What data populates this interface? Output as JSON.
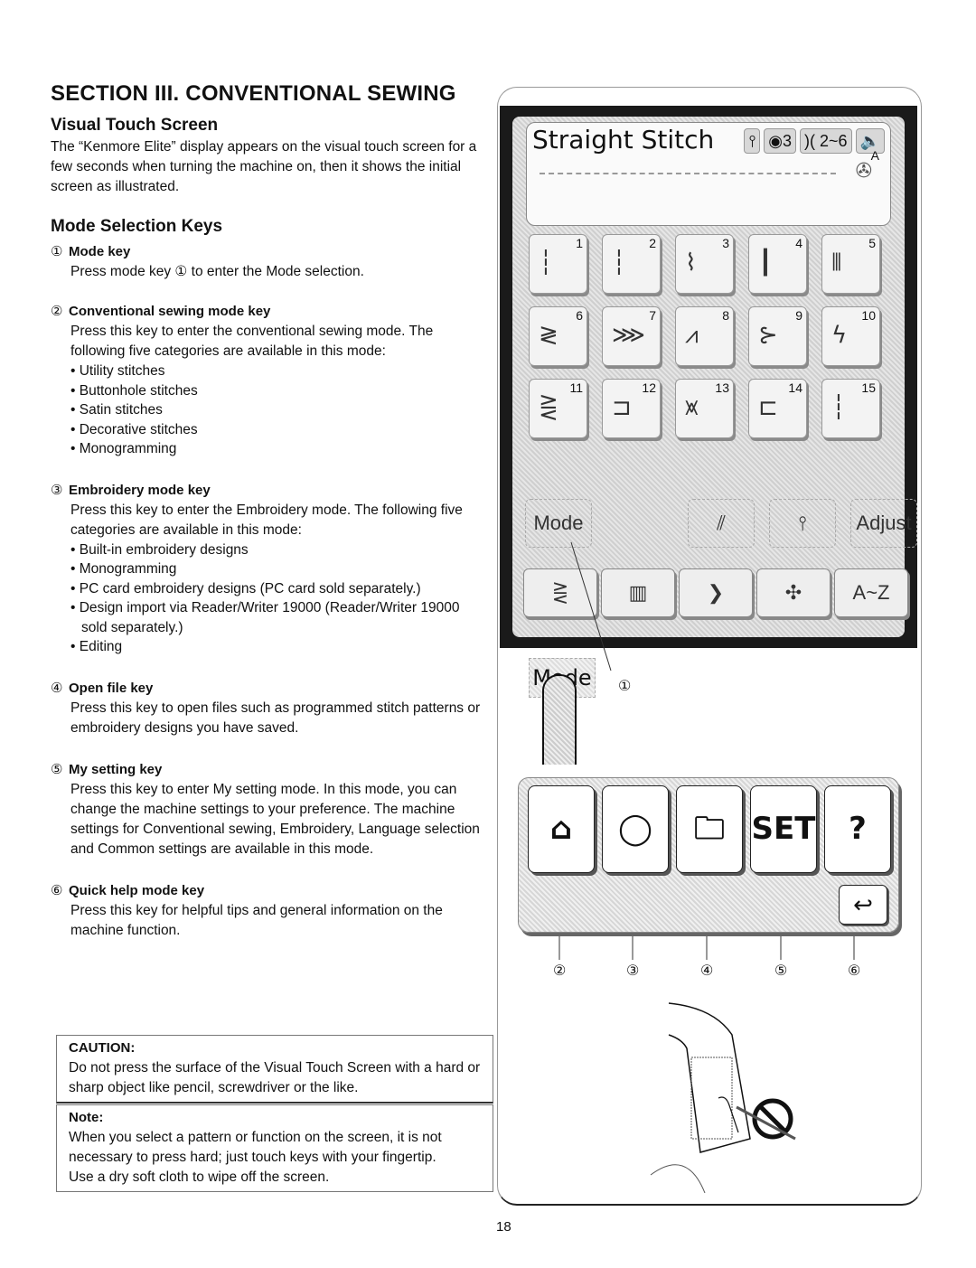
{
  "section_title": "SECTION III. CONVENTIONAL SEWING",
  "visual_touch": {
    "heading": "Visual Touch Screen",
    "body": "The “Kenmore Elite” display appears on the visual touch screen for a few seconds when turning the machine on, then it shows the initial screen as illustrated."
  },
  "mode_selection": {
    "heading": "Mode Selection Keys",
    "items": [
      {
        "num": "①",
        "title": "Mode key",
        "body": "Press mode key ① to enter the Mode selection.",
        "bullets": [],
        "extra": ""
      },
      {
        "num": "②",
        "title": "Conventional sewing mode key",
        "body": "Press this key to enter the conventional sewing mode. The following five categories are available in this mode:",
        "bullets": [
          "Utility stitches",
          "Buttonhole stitches",
          "Satin stitches",
          "Decorative stitches",
          "Monogramming"
        ]
      },
      {
        "num": "③",
        "title": "Embroidery mode key",
        "body": "Press this key to enter the Embroidery mode. The following five categories are available in this mode:",
        "bullets": [
          "Built-in embroidery designs",
          "Monogramming",
          "PC card embroidery designs (PC card sold separately.)",
          "Design import via Reader/Writer 19000 (Reader/Writer 19000 sold separately.)",
          "Editing"
        ]
      },
      {
        "num": "④",
        "title": "Open file key",
        "body": "Press this key to open files such as programmed stitch patterns or embroidery designs you have saved.",
        "bullets": []
      },
      {
        "num": "⑤",
        "title": "My setting key",
        "body": "Press this key to enter My setting mode. In this mode, you can change the machine settings to your preference. The machine settings for Conventional sewing, Embroidery, Language selection and Common settings are available in this mode.",
        "bullets": []
      },
      {
        "num": "⑥",
        "title": "Quick help mode key",
        "body": "Press this key for helpful tips and general information on the machine function.",
        "bullets": []
      }
    ]
  },
  "caution": {
    "title": "CAUTION:",
    "body": "Do not press the surface of the Visual Touch Screen with a hard or sharp object like pencil, screwdriver or the like."
  },
  "note": {
    "title": "Note:",
    "lines": [
      "When you select a pattern or function on the screen, it is not necessary to press hard; just touch keys with your fingertip.",
      "Use a dry soft cloth to wipe off the screen."
    ]
  },
  "page_number": "18",
  "screen": {
    "title": "Straight Stitch",
    "status_icons": [
      {
        "icon": "needle-icon",
        "glyph": "⫯",
        "text": ""
      },
      {
        "icon": "tension-dial-icon",
        "glyph": "◉",
        "text": "3"
      },
      {
        "icon": "presser-foot-pressure-icon",
        "glyph": ")(",
        "text": "2~6"
      },
      {
        "icon": "speaker-icon",
        "glyph": "🔈",
        "text": ""
      }
    ],
    "foot_label": "A",
    "stitch_keys": [
      {
        "n": "1",
        "g": "┆"
      },
      {
        "n": "2",
        "g": "┆"
      },
      {
        "n": "3",
        "g": "⌇"
      },
      {
        "n": "4",
        "g": "┃"
      },
      {
        "n": "5",
        "g": "⦀"
      },
      {
        "n": "6",
        "g": "≷"
      },
      {
        "n": "7",
        "g": "⋙"
      },
      {
        "n": "8",
        "g": "⩘"
      },
      {
        "n": "9",
        "g": "⊱"
      },
      {
        "n": "10",
        "g": "ϟ"
      },
      {
        "n": "11",
        "g": "⋛"
      },
      {
        "n": "12",
        "g": "⊐"
      },
      {
        "n": "13",
        "g": "⩙"
      },
      {
        "n": "14",
        "g": "⊏"
      },
      {
        "n": "15",
        "g": "┆"
      }
    ],
    "function_keys": {
      "mode": "Mode",
      "twin_needle": "⫽",
      "needle_up_down": "⫯",
      "adjust": "Adjust"
    },
    "category_tabs": [
      "⋛",
      "▥",
      "❯",
      "✣",
      "A~Z"
    ]
  },
  "mode_press": {
    "label": "Mode",
    "callout": "①"
  },
  "mode_menu": {
    "keys": [
      {
        "icon": "sewing-machine-icon",
        "glyph": "⌂"
      },
      {
        "icon": "embroidery-machine-icon",
        "glyph": "◯"
      },
      {
        "icon": "open-folder-icon",
        "glyph": "🗀"
      },
      {
        "icon": "set-icon",
        "glyph": "SET"
      },
      {
        "icon": "help-icon",
        "glyph": "?"
      }
    ],
    "back_glyph": "↩",
    "callouts": [
      "②",
      "③",
      "④",
      "⑤",
      "⑥"
    ]
  }
}
